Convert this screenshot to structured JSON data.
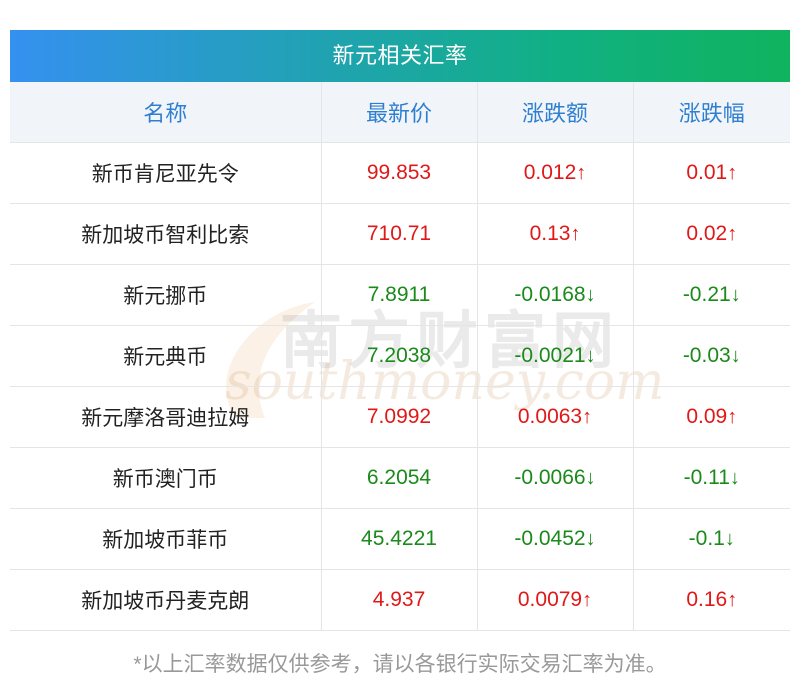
{
  "title": "新元相关汇率",
  "columns": [
    "名称",
    "最新价",
    "涨跌额",
    "涨跌幅"
  ],
  "rows": [
    {
      "name": "新币肯尼亚先令",
      "price": "99.853",
      "change": "0.012",
      "pct": "0.01",
      "arrow": "↑",
      "direction": "up"
    },
    {
      "name": "新加坡币智利比索",
      "price": "710.71",
      "change": "0.13",
      "pct": "0.02",
      "arrow": "↑",
      "direction": "up"
    },
    {
      "name": "新元挪币",
      "price": "7.8911",
      "change": "-0.0168",
      "pct": "-0.21",
      "arrow": "↓",
      "direction": "down"
    },
    {
      "name": "新元典币",
      "price": "7.2038",
      "change": "-0.0021",
      "pct": "-0.03",
      "arrow": "↓",
      "direction": "down"
    },
    {
      "name": "新元摩洛哥迪拉姆",
      "price": "7.0992",
      "change": "0.0063",
      "pct": "0.09",
      "arrow": "↑",
      "direction": "up"
    },
    {
      "name": "新币澳门币",
      "price": "6.2054",
      "change": "-0.0066",
      "pct": "-0.11",
      "arrow": "↓",
      "direction": "down"
    },
    {
      "name": "新加坡币菲币",
      "price": "45.4221",
      "change": "-0.0452",
      "pct": "-0.1",
      "arrow": "↓",
      "direction": "down"
    },
    {
      "name": "新加坡币丹麦克朗",
      "price": "4.937",
      "change": "0.0079",
      "pct": "0.16",
      "arrow": "↑",
      "direction": "up"
    }
  ],
  "watermark": {
    "cn": "南方财富网",
    "en": "southmoney.com"
  },
  "footnote": "*以上汇率数据仅供参考，请以各银行实际交易汇率为准。",
  "colors": {
    "up": "#e01818",
    "down": "#1a8a1a",
    "header_text": "#2f7fd1"
  }
}
